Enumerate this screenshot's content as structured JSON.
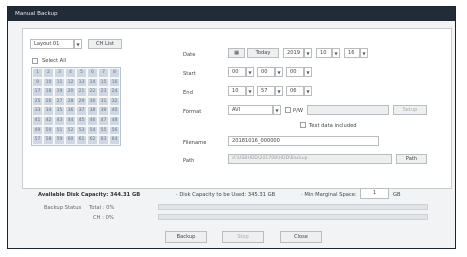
{
  "window": {
    "title": "Manual Backup"
  },
  "camera": {
    "layout_value": "Layout 01",
    "ch_list_label": "CH List",
    "select_all_label": "Select All",
    "channels": [
      "1",
      "2",
      "3",
      "4",
      "5",
      "6",
      "7",
      "8",
      "9",
      "10",
      "11",
      "12",
      "13",
      "14",
      "15",
      "16",
      "17",
      "18",
      "19",
      "20",
      "21",
      "22",
      "23",
      "24",
      "25",
      "26",
      "27",
      "28",
      "29",
      "30",
      "31",
      "32",
      "33",
      "34",
      "35",
      "36",
      "37",
      "38",
      "39",
      "40",
      "41",
      "42",
      "43",
      "44",
      "45",
      "46",
      "47",
      "48",
      "49",
      "50",
      "51",
      "52",
      "53",
      "54",
      "55",
      "56",
      "57",
      "58",
      "59",
      "60",
      "61",
      "62",
      "63",
      "64"
    ]
  },
  "date": {
    "label": "Date",
    "today_label": "Today",
    "year": "2019",
    "month": "10",
    "day": "16"
  },
  "start": {
    "label": "Start",
    "hh": "00",
    "mm": "00",
    "ss": "00"
  },
  "end": {
    "label": "End",
    "hh": "10",
    "mm": "57",
    "ss": "06"
  },
  "format": {
    "label": "Format",
    "value": "AVI",
    "pw_label": "P/W",
    "pw_value": "",
    "setup_label": "Setup",
    "text_data_label": "Text data included"
  },
  "filename": {
    "label": "Filename",
    "value": "20181016_000000"
  },
  "path": {
    "label": "Path",
    "value": "d:\\USBHDD\\201708\\HDD\\Backup",
    "button_label": "Path"
  },
  "capacity": {
    "available_label": "Available Disk Capacity:",
    "available_value": "344.31 GB",
    "used_label": "Disk Capacity to be Used:",
    "used_value": "345.31 GB",
    "margin_label": "Min Marginal Space:",
    "margin_value": "1",
    "margin_unit": "GB"
  },
  "status": {
    "label": "Backup Status",
    "total_label": "Total : 0%",
    "ch_label": "CH : 0%",
    "total_progress": 0,
    "ch_progress": 0
  },
  "buttons": {
    "backup": "Backup",
    "stop": "Stop",
    "close": "Close"
  }
}
